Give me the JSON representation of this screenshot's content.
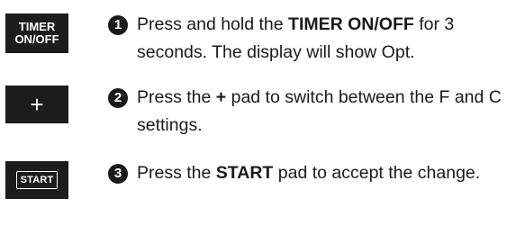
{
  "steps": [
    {
      "number": "1",
      "pad_lines": [
        "TIMER",
        "ON/OFF"
      ],
      "text_before": "Press and hold the ",
      "text_bold": "TIMER ON/OFF",
      "text_after": " for 3 seconds. The display will show Opt."
    },
    {
      "number": "2",
      "pad_label": "+",
      "text_before": "Press the ",
      "text_bold": "+",
      "text_after": " pad to switch between the F and C settings."
    },
    {
      "number": "3",
      "pad_label": "START",
      "text_before": "Press the ",
      "text_bold": "START",
      "text_after": " pad to accept the change."
    }
  ],
  "colors": {
    "pad_background": "#1c1c1c",
    "pad_text": "#ffffff",
    "body_text": "#1a1a1a"
  },
  "icons": {
    "step_number_badge": "filled-circle-number"
  }
}
